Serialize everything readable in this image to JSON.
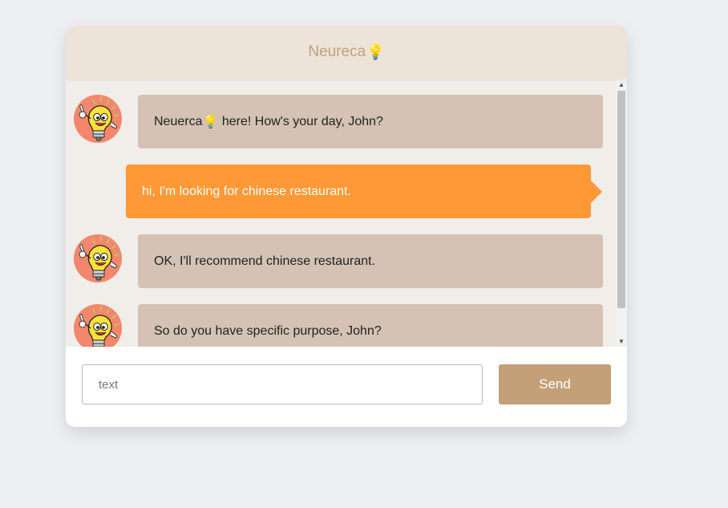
{
  "header": {
    "title": "Neureca",
    "title_icon": "💡"
  },
  "messages": [
    {
      "sender": "bot",
      "text_prefix": "Neuerca",
      "icon": "💡",
      "text": " here! How's your day, John?"
    },
    {
      "sender": "user",
      "text": "hi, I'm looking for chinese restaurant."
    },
    {
      "sender": "bot",
      "text": "OK, I'll recommend chinese restaurant."
    },
    {
      "sender": "bot",
      "text": "So do you have specific purpose, John?"
    }
  ],
  "input": {
    "placeholder": "text",
    "value": ""
  },
  "send": {
    "label": "Send"
  },
  "colors": {
    "header_bg": "#ede3d8",
    "header_text": "#c3a17a",
    "bot_bubble": "#d5c2b4",
    "user_bubble": "#ff9836",
    "send_button": "#c3a077"
  },
  "icons": {
    "avatar": "lightbulb-mascot-avatar",
    "title": "lightbulb-icon"
  }
}
